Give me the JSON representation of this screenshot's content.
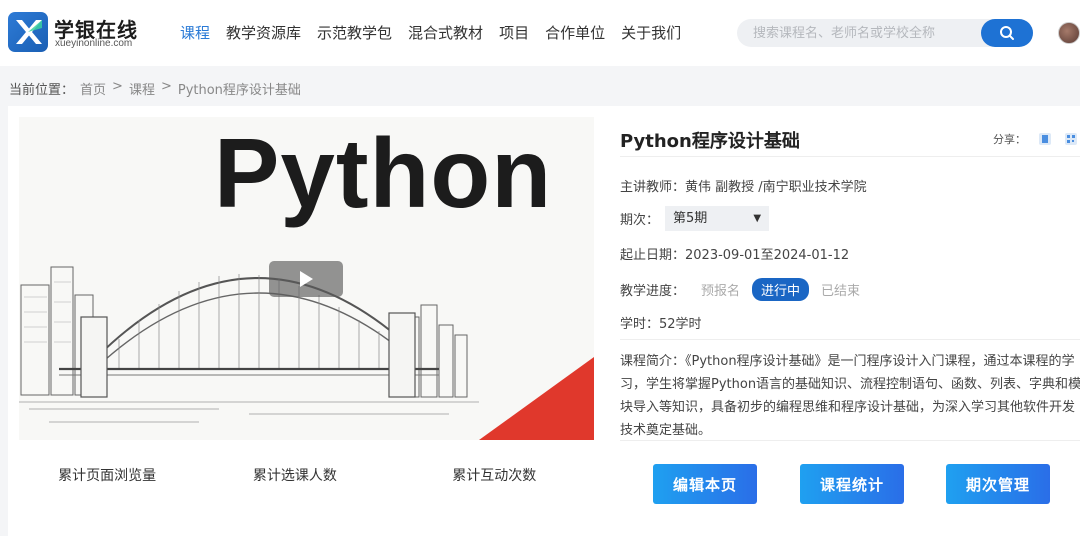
{
  "header": {
    "brand": "学银在线",
    "brand_sub": "xueyinonline.com",
    "nav": [
      "课程",
      "教学资源库",
      "示范教学包",
      "混合式教材",
      "项目",
      "合作单位",
      "关于我们"
    ],
    "search_placeholder": "搜索课程名、老师名或学校全称"
  },
  "breadcrumb": {
    "label": "当前位置：",
    "items": [
      "首页",
      ">",
      "课程",
      ">",
      "Python程序设计基础"
    ]
  },
  "cover": {
    "title": "Python"
  },
  "stats": [
    "累计页面浏览量",
    "累计选课人数",
    "累计互动次数"
  ],
  "course": {
    "title": "Python程序设计基础",
    "share_label": "分享：",
    "teacher_label": "主讲教师：",
    "teacher_value": "黄伟 副教授 /南宁职业技术学院",
    "term_label": "期次：",
    "term_value": "第5期",
    "date_label": "起止日期：",
    "date_value": "2023-09-01至2024-01-12",
    "progress_label": "教学进度：",
    "progress_items": [
      "预报名",
      "进行中",
      "已结束"
    ],
    "hours_label": "学时：",
    "hours_value": "52学时",
    "intro": "课程简介：《Python程序设计基础》是一门程序设计入门课程，通过本课程的学习，学生将掌握Python语言的基础知识、流程控制语句、函数、列表、字典和模块导入等知识，具备初步的编程思维和程序设计基础，为深入学习其他软件开发技术奠定基础。"
  },
  "buttons": {
    "edit": "编辑本页",
    "stats": "课程统计",
    "terms": "期次管理"
  },
  "colors": {
    "accent": "#1e72d4",
    "progress_active": "#1a66c4",
    "cover_accent": "#e0382c"
  }
}
